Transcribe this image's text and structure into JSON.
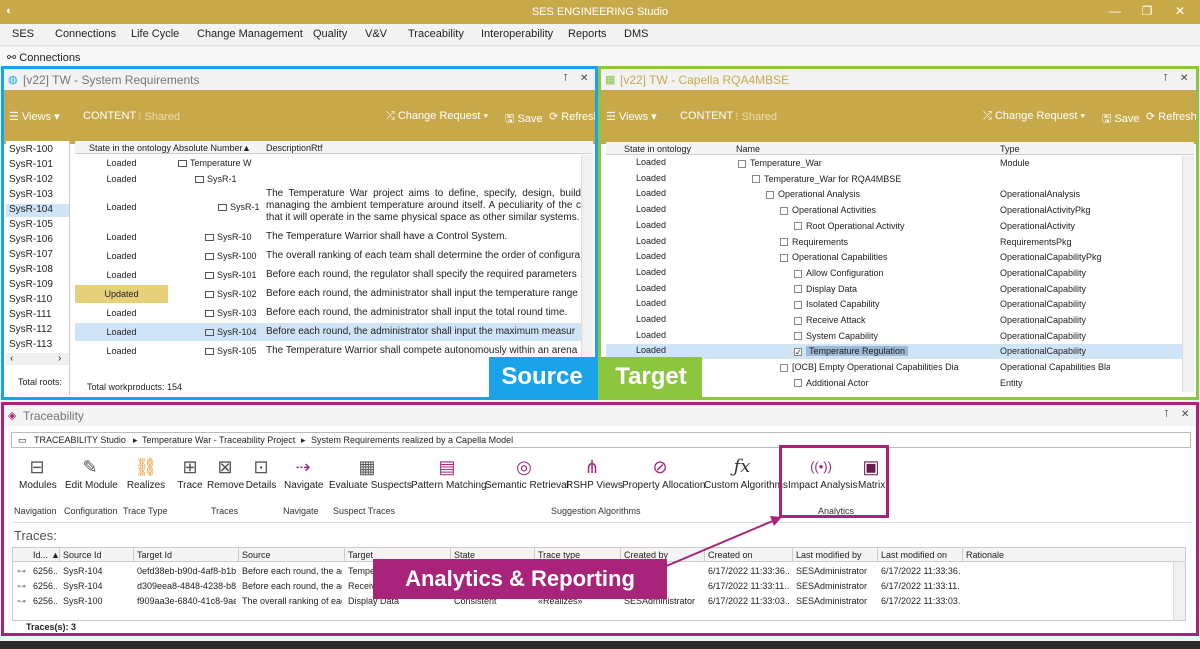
{
  "app": {
    "title": "SES ENGINEERING Studio"
  },
  "menu": [
    "SES",
    "Connections",
    "Life Cycle",
    "Change Management",
    "Quality",
    "V&V",
    "Traceability",
    "Interoperability",
    "Reports",
    "DMS"
  ],
  "conn_label": "Connections",
  "left": {
    "title": "[v22] TW - System Requirements",
    "toolbar": {
      "views": "Views",
      "content": "CONTENT",
      "shared": "Shared",
      "cr": "Change Request",
      "save": "Save",
      "refresh": "Refresh"
    },
    "ids": [
      "SysR-100",
      "SysR-101",
      "SysR-102",
      "SysR-103",
      "SysR-104",
      "SysR-105",
      "SysR-106",
      "SysR-107",
      "SysR-108",
      "SysR-109",
      "SysR-110",
      "SysR-111",
      "SysR-112",
      "SysR-113"
    ],
    "total_roots": "Total roots:",
    "headers": [
      "State in the ontology",
      "Absolute Number",
      "DescriptionRtf"
    ],
    "rows": [
      {
        "state": "Loaded",
        "num": "Temperature W",
        "desc": ""
      },
      {
        "state": "Loaded",
        "num": "SysR-1",
        "desc": ""
      },
      {
        "state": "Loaded",
        "num": "SysR-1",
        "desc": "The Temperature War project aims to define, specify, design, build managing the ambient temperature around itself. A peculiarity of the c that it will operate in the same physical space as other similar systems."
      },
      {
        "state": "Loaded",
        "num": "SysR-10",
        "desc": "The Temperature Warrior shall have a Control System."
      },
      {
        "state": "Loaded",
        "num": "SysR-100",
        "desc": "The overall ranking of each team shall determine the order of configura"
      },
      {
        "state": "Loaded",
        "num": "SysR-101",
        "desc": "Before each round, the regulator shall specify the required parameters"
      },
      {
        "state": "Updated",
        "num": "SysR-102",
        "desc": "Before each round, the administrator shall input the temperature range"
      },
      {
        "state": "Loaded",
        "num": "SysR-103",
        "desc": "Before each round, the administrator shall input the total round time."
      },
      {
        "state": "Loaded",
        "num": "SysR-104",
        "desc": "Before each round, the administrator shall input the maximum measur"
      },
      {
        "state": "Loaded",
        "num": "SysR-105",
        "desc": "The Temperature Warrior shall compete autonomously within an arena"
      }
    ],
    "total": "Total workproducts: 154"
  },
  "right": {
    "title": "[v22] TW - Capella RQA4MBSE",
    "toolbar": {
      "views": "Views",
      "content": "CONTENT",
      "shared": "Shared",
      "cr": "Change Request",
      "save": "Save",
      "refresh": "Refresh"
    },
    "headers": [
      "State in ontology",
      "Name",
      "Type"
    ],
    "rows": [
      {
        "state": "Loaded",
        "name": "Temperature_War",
        "type": "Module",
        "ind": 0
      },
      {
        "state": "Loaded",
        "name": "Temperature_War for RQA4MBSE",
        "type": "",
        "ind": 1
      },
      {
        "state": "Loaded",
        "name": "Operational Analysis",
        "type": "OperationalAnalysis",
        "ind": 2
      },
      {
        "state": "Loaded",
        "name": "Operational Activities",
        "type": "OperationalActivityPkg",
        "ind": 3
      },
      {
        "state": "Loaded",
        "name": "Root Operational Activity",
        "type": "OperationalActivity",
        "ind": 4
      },
      {
        "state": "Loaded",
        "name": "Requirements",
        "type": "RequirementsPkg",
        "ind": 3
      },
      {
        "state": "Loaded",
        "name": "Operational Capabilities",
        "type": "OperationalCapabilityPkg",
        "ind": 3
      },
      {
        "state": "Loaded",
        "name": "Allow Configuration",
        "type": "OperationalCapability",
        "ind": 4
      },
      {
        "state": "Loaded",
        "name": "Display Data",
        "type": "OperationalCapability",
        "ind": 4
      },
      {
        "state": "Loaded",
        "name": "Isolated Capability",
        "type": "OperationalCapability",
        "ind": 4
      },
      {
        "state": "Loaded",
        "name": "Receive Attack",
        "type": "OperationalCapability",
        "ind": 4
      },
      {
        "state": "Loaded",
        "name": "System Capability",
        "type": "OperationalCapability",
        "ind": 4
      },
      {
        "state": "Loaded",
        "name": "Temperature Regulation",
        "type": "OperationalCapability",
        "ind": 4
      },
      {
        "state": "Loaded",
        "name": "[OCB] Empty Operational Capabilities Dia",
        "type": "Operational Capabilities Blank",
        "ind": 3
      },
      {
        "state": "",
        "name": "Additional Actor",
        "type": "Entity",
        "ind": 4
      }
    ]
  },
  "labels": {
    "source": "Source",
    "target": "Target",
    "analytics": "Analytics & Reporting"
  },
  "trace": {
    "title": "Traceability",
    "breadcrumb": [
      "TRACEABILITY Studio",
      "Temperature War - Traceability Project",
      "System Requirements realized by a Capella Model"
    ],
    "ribbon": [
      "Modules",
      "Edit Module",
      "Realizes",
      "Trace",
      "Remove",
      "Details",
      "Navigate",
      "Evaluate Suspects",
      "Pattern Matching",
      "Semantic Retrieval",
      "RSHP Views",
      "Property Allocation",
      "Custom Algorithms",
      "Impact Analysis",
      "Matrix"
    ],
    "groups": [
      "Navigation",
      "Configuration",
      "Trace Type",
      "Traces",
      "Navigate",
      "Suspect Traces",
      "Suggestion Algorithms",
      "Analytics"
    ],
    "traces_label": "Traces:",
    "headers": [
      "Id...",
      "Source Id",
      "Target Id",
      "Source",
      "Target",
      "State",
      "Trace type",
      "Created by",
      "Created on",
      "Last modified by",
      "Last modified on",
      "Rationale"
    ],
    "rows": [
      [
        "6256...",
        "SysR-104",
        "0efd38eb-b90d-4af8-b1b...",
        "Before each round, the ad...",
        "Tempe",
        "",
        "",
        "",
        "6/17/2022 11:33:36...",
        "SESAdministrator",
        "6/17/2022 11:33:36...",
        ""
      ],
      [
        "6256...",
        "SysR-104",
        "d309eea8-4848-4238-b8...",
        "Before each round, the ad...",
        "Receiv",
        "",
        "",
        "",
        "6/17/2022 11:33:11...",
        "SESAdministrator",
        "6/17/2022 11:33:11...",
        ""
      ],
      [
        "6256...",
        "SysR-100",
        "f909aa3e-6840-41c8-9ae...",
        "The overall ranking of eac...",
        "Display Data",
        "Consistent",
        "«Realizes»",
        "SESAdministrator",
        "6/17/2022 11:33:03...",
        "SESAdministrator",
        "6/17/2022 11:33:03...",
        ""
      ]
    ],
    "count": "Traces(s): 3"
  },
  "colors": {
    "gold": "#c8a94a",
    "blue": "#1aa3e8",
    "green": "#8cc63f",
    "magenta": "#a8247a"
  }
}
